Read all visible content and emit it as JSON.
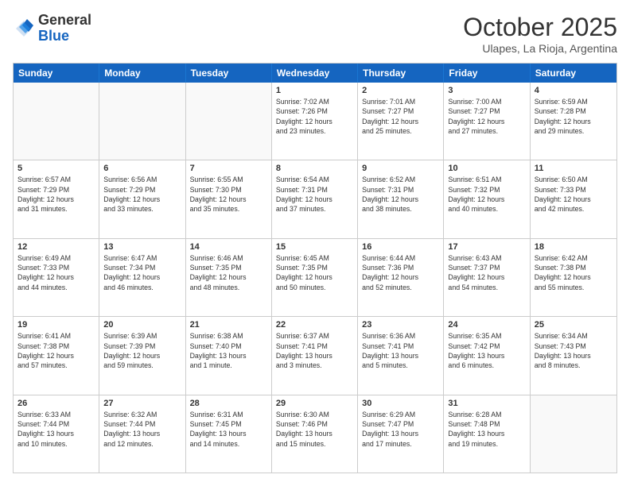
{
  "logo": {
    "general": "General",
    "blue": "Blue"
  },
  "title": "October 2025",
  "subtitle": "Ulapes, La Rioja, Argentina",
  "days": [
    "Sunday",
    "Monday",
    "Tuesday",
    "Wednesday",
    "Thursday",
    "Friday",
    "Saturday"
  ],
  "weeks": [
    [
      {
        "date": "",
        "info": ""
      },
      {
        "date": "",
        "info": ""
      },
      {
        "date": "",
        "info": ""
      },
      {
        "date": "1",
        "info": "Sunrise: 7:02 AM\nSunset: 7:26 PM\nDaylight: 12 hours\nand 23 minutes."
      },
      {
        "date": "2",
        "info": "Sunrise: 7:01 AM\nSunset: 7:27 PM\nDaylight: 12 hours\nand 25 minutes."
      },
      {
        "date": "3",
        "info": "Sunrise: 7:00 AM\nSunset: 7:27 PM\nDaylight: 12 hours\nand 27 minutes."
      },
      {
        "date": "4",
        "info": "Sunrise: 6:59 AM\nSunset: 7:28 PM\nDaylight: 12 hours\nand 29 minutes."
      }
    ],
    [
      {
        "date": "5",
        "info": "Sunrise: 6:57 AM\nSunset: 7:29 PM\nDaylight: 12 hours\nand 31 minutes."
      },
      {
        "date": "6",
        "info": "Sunrise: 6:56 AM\nSunset: 7:29 PM\nDaylight: 12 hours\nand 33 minutes."
      },
      {
        "date": "7",
        "info": "Sunrise: 6:55 AM\nSunset: 7:30 PM\nDaylight: 12 hours\nand 35 minutes."
      },
      {
        "date": "8",
        "info": "Sunrise: 6:54 AM\nSunset: 7:31 PM\nDaylight: 12 hours\nand 37 minutes."
      },
      {
        "date": "9",
        "info": "Sunrise: 6:52 AM\nSunset: 7:31 PM\nDaylight: 12 hours\nand 38 minutes."
      },
      {
        "date": "10",
        "info": "Sunrise: 6:51 AM\nSunset: 7:32 PM\nDaylight: 12 hours\nand 40 minutes."
      },
      {
        "date": "11",
        "info": "Sunrise: 6:50 AM\nSunset: 7:33 PM\nDaylight: 12 hours\nand 42 minutes."
      }
    ],
    [
      {
        "date": "12",
        "info": "Sunrise: 6:49 AM\nSunset: 7:33 PM\nDaylight: 12 hours\nand 44 minutes."
      },
      {
        "date": "13",
        "info": "Sunrise: 6:47 AM\nSunset: 7:34 PM\nDaylight: 12 hours\nand 46 minutes."
      },
      {
        "date": "14",
        "info": "Sunrise: 6:46 AM\nSunset: 7:35 PM\nDaylight: 12 hours\nand 48 minutes."
      },
      {
        "date": "15",
        "info": "Sunrise: 6:45 AM\nSunset: 7:35 PM\nDaylight: 12 hours\nand 50 minutes."
      },
      {
        "date": "16",
        "info": "Sunrise: 6:44 AM\nSunset: 7:36 PM\nDaylight: 12 hours\nand 52 minutes."
      },
      {
        "date": "17",
        "info": "Sunrise: 6:43 AM\nSunset: 7:37 PM\nDaylight: 12 hours\nand 54 minutes."
      },
      {
        "date": "18",
        "info": "Sunrise: 6:42 AM\nSunset: 7:38 PM\nDaylight: 12 hours\nand 55 minutes."
      }
    ],
    [
      {
        "date": "19",
        "info": "Sunrise: 6:41 AM\nSunset: 7:38 PM\nDaylight: 12 hours\nand 57 minutes."
      },
      {
        "date": "20",
        "info": "Sunrise: 6:39 AM\nSunset: 7:39 PM\nDaylight: 12 hours\nand 59 minutes."
      },
      {
        "date": "21",
        "info": "Sunrise: 6:38 AM\nSunset: 7:40 PM\nDaylight: 13 hours\nand 1 minute."
      },
      {
        "date": "22",
        "info": "Sunrise: 6:37 AM\nSunset: 7:41 PM\nDaylight: 13 hours\nand 3 minutes."
      },
      {
        "date": "23",
        "info": "Sunrise: 6:36 AM\nSunset: 7:41 PM\nDaylight: 13 hours\nand 5 minutes."
      },
      {
        "date": "24",
        "info": "Sunrise: 6:35 AM\nSunset: 7:42 PM\nDaylight: 13 hours\nand 6 minutes."
      },
      {
        "date": "25",
        "info": "Sunrise: 6:34 AM\nSunset: 7:43 PM\nDaylight: 13 hours\nand 8 minutes."
      }
    ],
    [
      {
        "date": "26",
        "info": "Sunrise: 6:33 AM\nSunset: 7:44 PM\nDaylight: 13 hours\nand 10 minutes."
      },
      {
        "date": "27",
        "info": "Sunrise: 6:32 AM\nSunset: 7:44 PM\nDaylight: 13 hours\nand 12 minutes."
      },
      {
        "date": "28",
        "info": "Sunrise: 6:31 AM\nSunset: 7:45 PM\nDaylight: 13 hours\nand 14 minutes."
      },
      {
        "date": "29",
        "info": "Sunrise: 6:30 AM\nSunset: 7:46 PM\nDaylight: 13 hours\nand 15 minutes."
      },
      {
        "date": "30",
        "info": "Sunrise: 6:29 AM\nSunset: 7:47 PM\nDaylight: 13 hours\nand 17 minutes."
      },
      {
        "date": "31",
        "info": "Sunrise: 6:28 AM\nSunset: 7:48 PM\nDaylight: 13 hours\nand 19 minutes."
      },
      {
        "date": "",
        "info": ""
      }
    ]
  ]
}
